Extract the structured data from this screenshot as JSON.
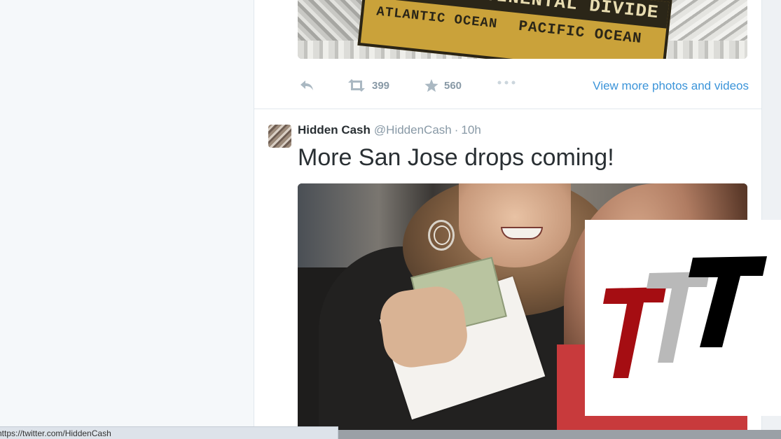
{
  "previous_tweet": {
    "photo_sign_text": {
      "top": "CONTINENTAL DIVIDE",
      "left": "ATLANTIC OCEAN",
      "right": "PACIFIC OCEAN"
    },
    "retweets": "399",
    "favorites": "560",
    "view_more_label": "View more photos and videos"
  },
  "tweet": {
    "author_name": "Hidden Cash",
    "author_handle": "@HiddenCash",
    "separator": "·",
    "time": "10h",
    "text": "More San Jose drops coming!"
  },
  "status_bar": {
    "url": "https://twitter.com/HiddenCash"
  },
  "colors": {
    "link": "#3b94d9",
    "action_gray": "#aab8c2",
    "logo_red": "#a50d12",
    "logo_gray": "#b9b9b9",
    "logo_black": "#000000"
  }
}
